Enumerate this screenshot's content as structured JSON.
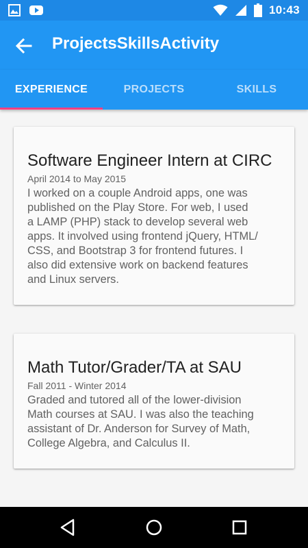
{
  "status_bar": {
    "time": "10:43",
    "left_icons": [
      "image-icon",
      "youtube-icon"
    ],
    "right_icons": [
      "wifi-icon",
      "signal-icon",
      "battery-icon"
    ]
  },
  "app_bar": {
    "title": "ProjectsSkillsActivity",
    "nav_icon": "back-arrow-icon"
  },
  "tabs": [
    {
      "label": "EXPERIENCE",
      "active": true
    },
    {
      "label": "PROJECTS",
      "active": false
    },
    {
      "label": "SKILLS",
      "active": false
    }
  ],
  "experience": [
    {
      "title": "Software Engineer Intern at CIRC",
      "dates": "April 2014 to May 2015",
      "description_lines": [
        "I worked on a couple Android apps, one was",
        "published on the Play Store. For web, I used",
        "a LAMP (PHP) stack to develop several web",
        "apps. It involved using frontend jQuery, HTML/",
        "CSS, and Bootstrap 3 for frontend futures. I",
        "also did extensive work on backend features",
        "and Linux servers."
      ]
    },
    {
      "title": "Math Tutor/Grader/TA at SAU",
      "dates": "Fall 2011 - Winter 2014",
      "description_lines": [
        "Graded and tutored all of the lower-division",
        "Math courses at SAU. I was also the teaching",
        "assistant of Dr. Anderson for Survey of Math,",
        "College Algebra, and Calculus II."
      ]
    }
  ],
  "nav_bar": {
    "buttons": [
      "back-triangle-icon",
      "home-circle-icon",
      "recents-square-icon"
    ]
  },
  "colors": {
    "status_bar": "#1E88E5",
    "app_bar": "#2196F3",
    "tab_indicator": "#FF4081",
    "background": "#F5F5F5"
  }
}
